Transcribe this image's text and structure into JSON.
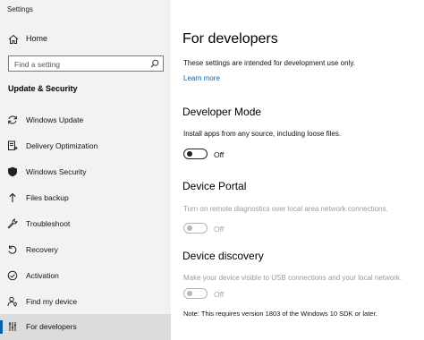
{
  "window": {
    "title": "Settings"
  },
  "sidebar": {
    "home_label": "Home",
    "search_placeholder": "Find a setting",
    "section_title": "Update & Security",
    "items": [
      {
        "label": "Windows Update",
        "icon": "sync-icon"
      },
      {
        "label": "Delivery Optimization",
        "icon": "delivery-optimization-icon"
      },
      {
        "label": "Windows Security",
        "icon": "shield-icon"
      },
      {
        "label": "Files backup",
        "icon": "backup-arrow-icon"
      },
      {
        "label": "Troubleshoot",
        "icon": "wrench-icon"
      },
      {
        "label": "Recovery",
        "icon": "recovery-icon"
      },
      {
        "label": "Activation",
        "icon": "activation-check-icon"
      },
      {
        "label": "Find my device",
        "icon": "person-location-icon"
      },
      {
        "label": "For developers",
        "icon": "developer-tools-icon",
        "selected": true
      }
    ]
  },
  "main": {
    "title": "For developers",
    "intro": "These settings are intended for development use only.",
    "learn_more": "Learn more",
    "developer_mode": {
      "heading": "Developer Mode",
      "description": "Install apps from any source, including loose files.",
      "toggle_state": "Off",
      "enabled": true
    },
    "device_portal": {
      "heading": "Device Portal",
      "description": "Turn on remote diagnostics over local area network connections.",
      "toggle_state": "Off",
      "enabled": false
    },
    "device_discovery": {
      "heading": "Device discovery",
      "description": "Make your device visible to USB connections and your local network.",
      "toggle_state": "Off",
      "enabled": false,
      "note": "Note: This requires version 1803 of the Windows 10 SDK or later."
    }
  },
  "colors": {
    "sidebar_bg": "#f2f2f2",
    "accent": "#0063b1",
    "link": "#0067b8",
    "disabled_text": "#9a9a9a"
  }
}
